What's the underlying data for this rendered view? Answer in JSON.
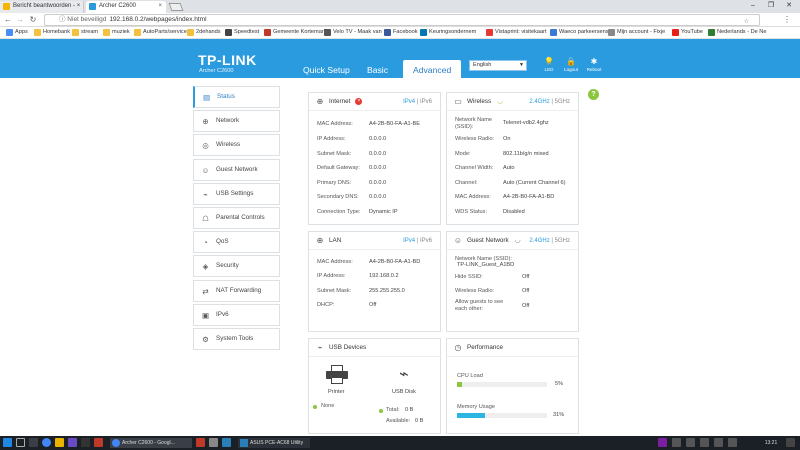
{
  "browser": {
    "tabs": [
      {
        "label": "Bericht beantwoorden - ×"
      },
      {
        "label": "Archer C2600"
      }
    ],
    "tab_close": "×",
    "url_secure": "ⓘ Niet beveiligd",
    "url": "192.168.0.2/webpages/index.html",
    "bookmarks": [
      "Apps",
      "Homebank",
      "stream",
      "muziek",
      "AutoParts/service",
      "2dehands",
      "Speedtest",
      "Gemeente Kortemark",
      "Velo TV - Maak van",
      "Facebook",
      "Keuringsondernem",
      "Vistaprint: visitekaart",
      "Waeco parkeersens",
      "Mijn account - Fixje",
      "YouTube",
      "Nederlands - De Ne"
    ]
  },
  "header": {
    "logo": "TP-LINK",
    "model": "Archer C2600",
    "tabs": [
      "Quick Setup",
      "Basic",
      "Advanced"
    ],
    "active_tab": "Advanced",
    "language": "English",
    "icons": [
      {
        "name": "led",
        "glyph": "💡",
        "label": "LED"
      },
      {
        "name": "logout",
        "glyph": "🔒",
        "label": "Logout"
      },
      {
        "name": "reboot",
        "glyph": "✱",
        "label": "Reboot"
      }
    ]
  },
  "help": "?",
  "sidebar": {
    "items": [
      {
        "name": "status",
        "label": "Status",
        "glyph": "▤"
      },
      {
        "name": "network",
        "label": "Network",
        "glyph": "⊕"
      },
      {
        "name": "wireless",
        "label": "Wireless",
        "glyph": "◎"
      },
      {
        "name": "guest-network",
        "label": "Guest Network",
        "glyph": "☺"
      },
      {
        "name": "usb-settings",
        "label": "USB Settings",
        "glyph": "⌁"
      },
      {
        "name": "parental-controls",
        "label": "Parental Controls",
        "glyph": "☖"
      },
      {
        "name": "qos",
        "label": "QoS",
        "glyph": "◔"
      },
      {
        "name": "security",
        "label": "Security",
        "glyph": "◈"
      },
      {
        "name": "nat-forwarding",
        "label": "NAT Forwarding",
        "glyph": "⇄"
      },
      {
        "name": "ipv6",
        "label": "IPv6",
        "glyph": "▣"
      },
      {
        "name": "system-tools",
        "label": "System Tools",
        "glyph": "⚙"
      }
    ]
  },
  "internet": {
    "title": "Internet",
    "err": "×",
    "mode_on": "IPv4",
    "mode_off": "IPv6",
    "rows": [
      {
        "label": "MAC Address:",
        "value": "A4-2B-B0-FA-A1-BE"
      },
      {
        "label": "IP Address:",
        "value": "0.0.0.0"
      },
      {
        "label": "Subnet Mask:",
        "value": "0.0.0.0"
      },
      {
        "label": "Default Gateway:",
        "value": "0.0.0.0"
      },
      {
        "label": "Primary DNS:",
        "value": "0.0.0.0"
      },
      {
        "label": "Secondary DNS:",
        "value": "0.0.0.0"
      },
      {
        "label": "Connection Type:",
        "value": "Dynamic IP"
      }
    ]
  },
  "wireless": {
    "title": "Wireless",
    "mode_on": "2.4GHz",
    "mode_off": "5GHz",
    "rows": [
      {
        "label": "Network Name (SSID):",
        "value": "Telenet-vdb2.4ghz"
      },
      {
        "label": "Wireless Radio:",
        "value": "On"
      },
      {
        "label": "Mode:",
        "value": "802.11b/g/n mixed"
      },
      {
        "label": "Channel Width:",
        "value": "Auto"
      },
      {
        "label": "Channel:",
        "value": "Auto (Current Channel 6)"
      },
      {
        "label": "MAC Address:",
        "value": "A4-2B-B0-FA-A1-BD"
      },
      {
        "label": "WDS Status:",
        "value": "Disabled"
      }
    ]
  },
  "lan": {
    "title": "LAN",
    "mode_on": "IPv4",
    "mode_off": "IPv6",
    "rows": [
      {
        "label": "MAC Address:",
        "value": "A4-2B-B0-FA-A1-BD"
      },
      {
        "label": "IP Address:",
        "value": "192.168.0.2"
      },
      {
        "label": "Subnet Mask:",
        "value": "255.255.255.0"
      },
      {
        "label": "DHCP:",
        "value": "Off"
      }
    ]
  },
  "guest": {
    "title": "Guest Network",
    "mode_on": "2.4GHz",
    "mode_off": "5GHz",
    "rows": [
      {
        "label": "Network Name (SSID):",
        "value": "TP-LINK_Guest_A1BD"
      },
      {
        "label": "Hide SSID:",
        "value": "Off"
      },
      {
        "label": "Wireless Radio:",
        "value": "Off"
      },
      {
        "label": "Allow guests to see each other:",
        "value": "Off"
      }
    ]
  },
  "usb": {
    "title": "USB Devices",
    "printer": "Printer",
    "printer_status": "None",
    "disk": "USB Disk",
    "total_label": "Total:",
    "total": "0 B",
    "available_label": "Available:",
    "available": "0 B"
  },
  "performance": {
    "title": "Performance",
    "cpu_label": "CPU Load",
    "cpu_value": "5%",
    "cpu": 0.05,
    "mem_label": "Memory Usage",
    "mem_value": "31%",
    "mem": 0.31
  },
  "taskbar": {
    "items": [
      "Archer C2600 - Googl...",
      "ASUS PCE-AC68 Utility"
    ],
    "time": "13:21"
  },
  "colors": {
    "accent": "#2b9be0",
    "green": "#8cc63e",
    "error": "#e53935",
    "mem_bar": "#2bb5e0",
    "cpu_bar": "#8cc63e"
  }
}
